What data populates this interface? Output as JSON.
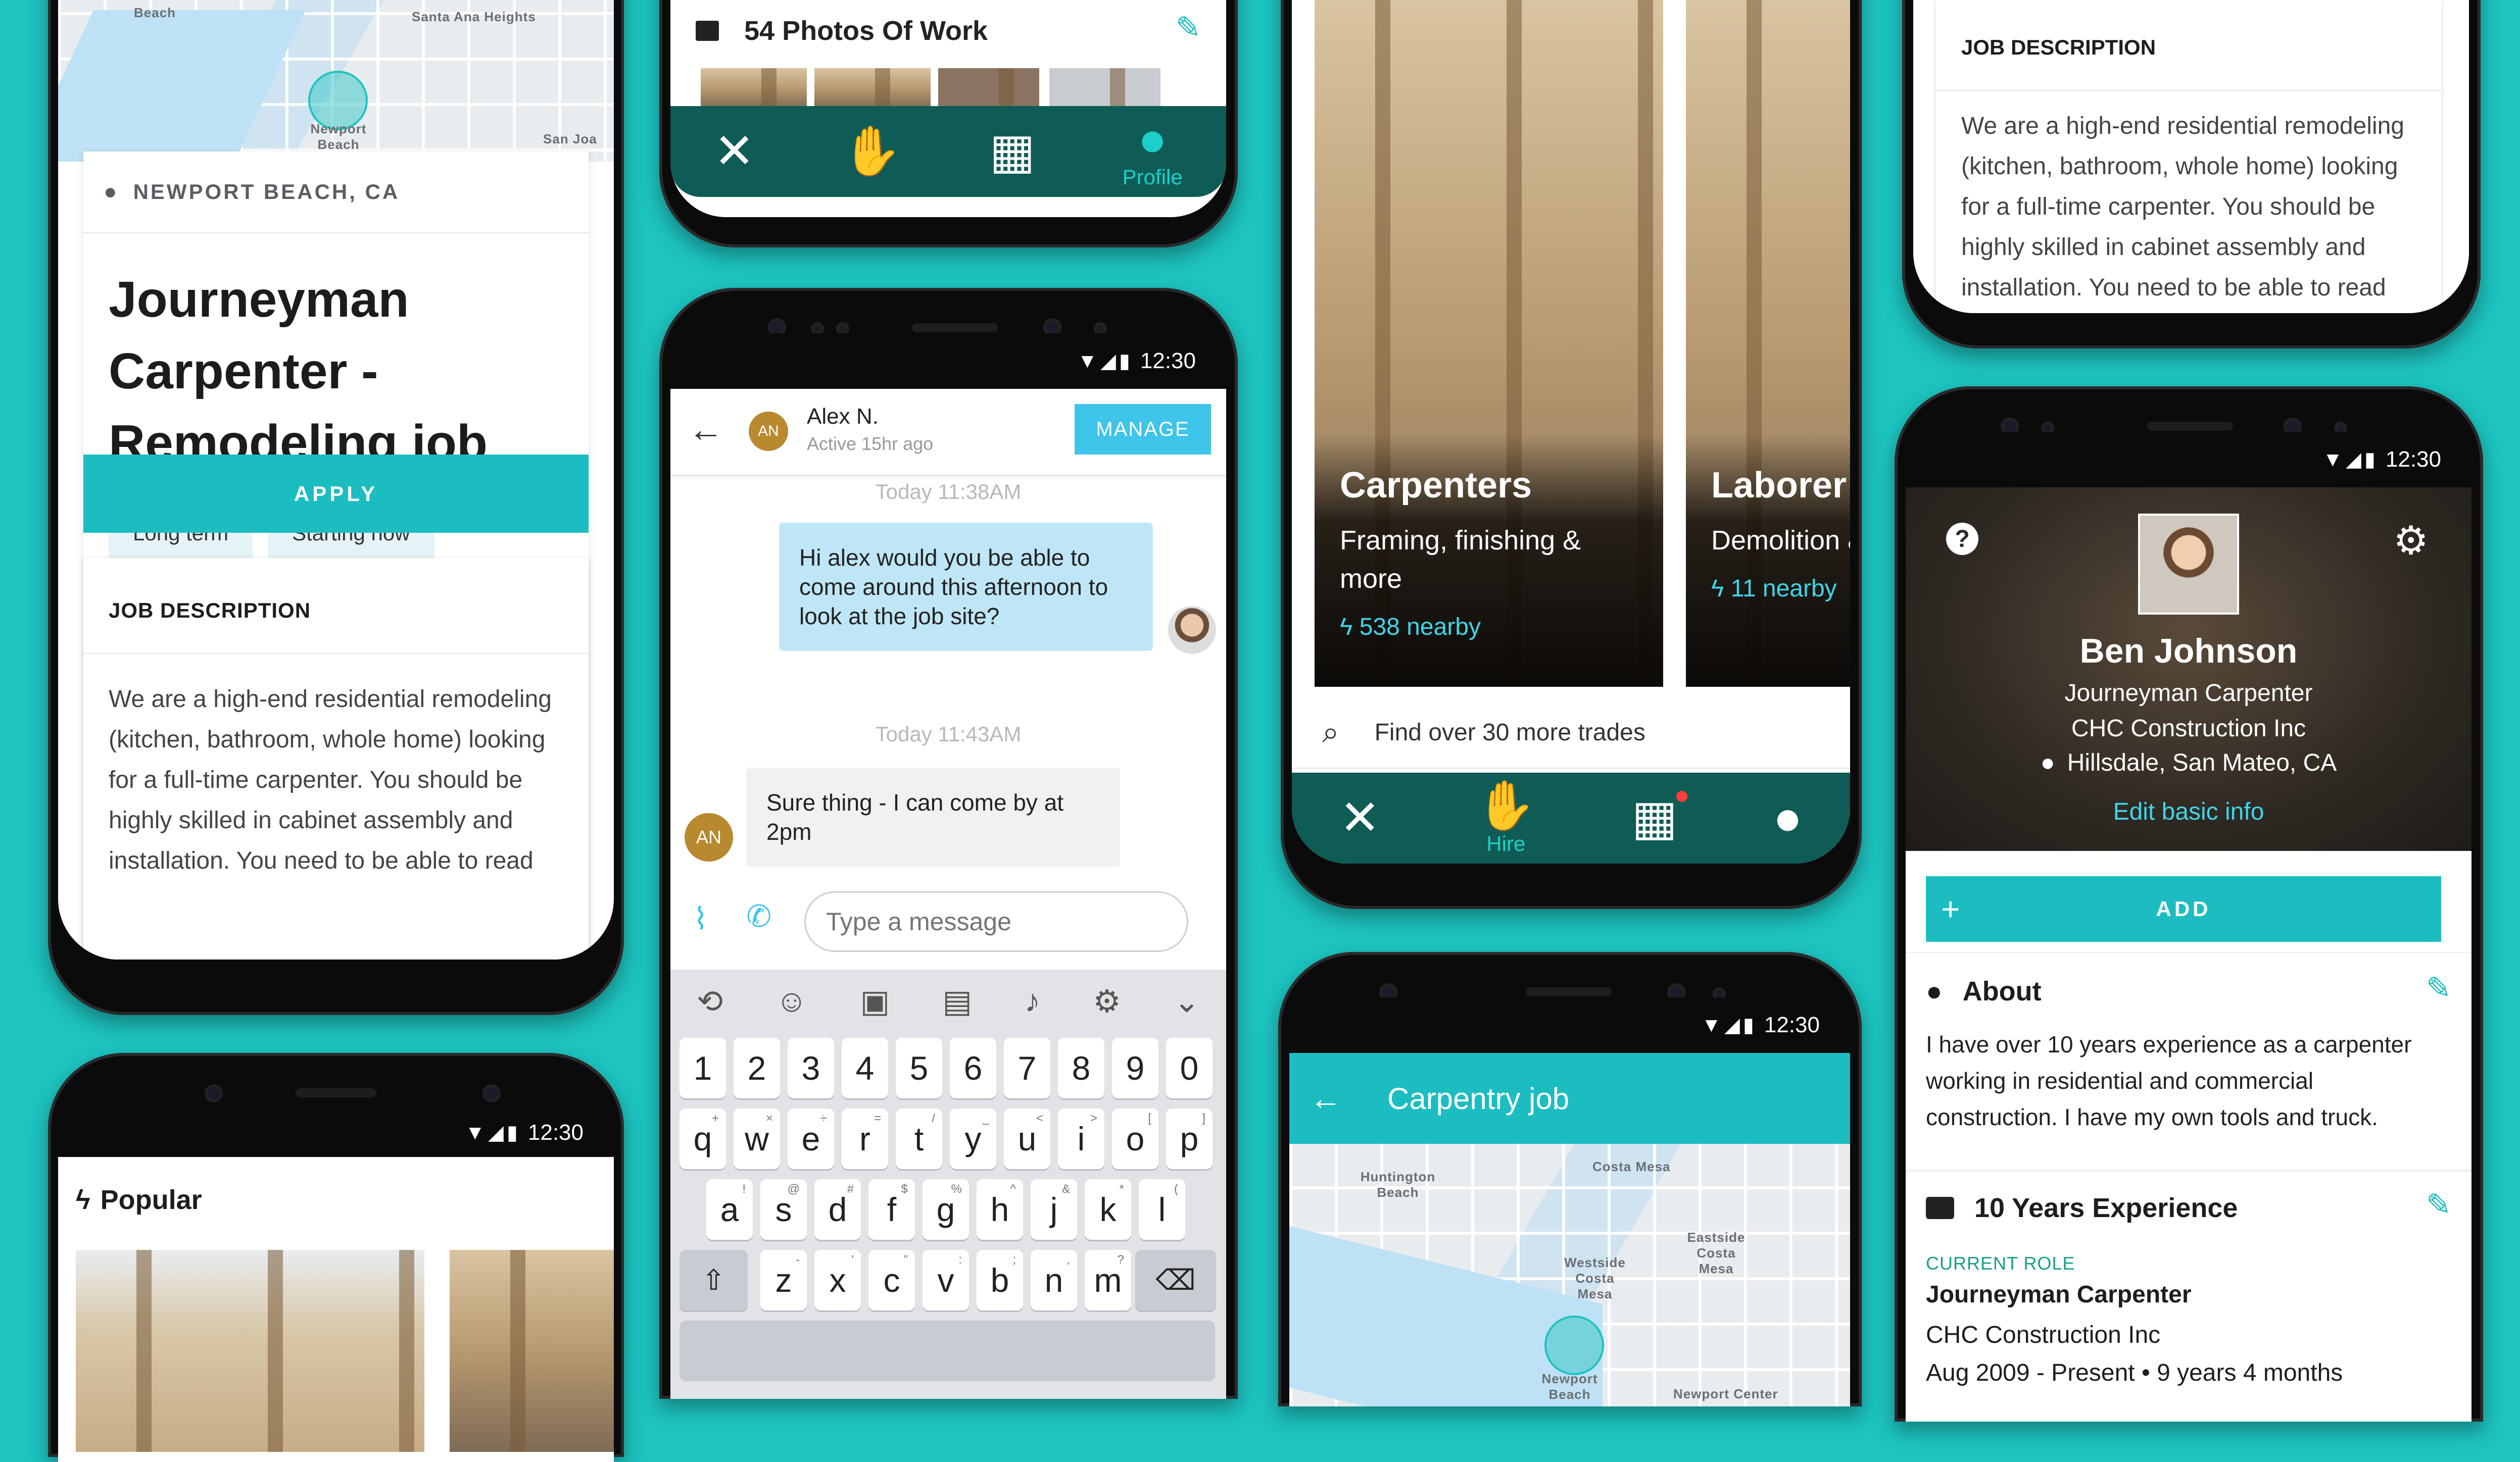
{
  "colors": {
    "background": "#1dc4c0",
    "accent": "#1bbdc1",
    "navbar": "#0f5c56"
  },
  "status_time": "12:30",
  "phone_job": {
    "map_labels": [
      "Beach",
      "Santa Ana Heights",
      "Newport Beach",
      "San Joa"
    ],
    "location": "NEWPORT BEACH, CA",
    "title": "Journeyman Carpenter - Remodeling job",
    "tags": [
      "Long term",
      "Starting now"
    ],
    "apply_label": "APPLY",
    "desc_heading": "JOB DESCRIPTION",
    "desc_text": "We are a high-end residential remodeling (kitchen, bathroom, whole home) looking for a full-time carpenter. You should be highly skilled in cabinet assembly and installation. You need to be able to read"
  },
  "phone_popular": {
    "heading": "Popular"
  },
  "phone_photos": {
    "title": "54 Photos Of Work",
    "nav": {
      "profile_label": "Profile"
    }
  },
  "phone_chat": {
    "contact_initials": "AN",
    "contact_name": "Alex N.",
    "contact_status": "Active 15hr ago",
    "manage_label": "MANAGE",
    "time1": "Today 11:38AM",
    "msg_out": "Hi alex would you be able to come around this afternoon to look at the job  site?",
    "time2": "Today 11:43AM",
    "msg_in": "Sure thing - I can come by at 2pm",
    "input_placeholder": "Type a message",
    "keyboard": {
      "numbers": [
        "1",
        "2",
        "3",
        "4",
        "5",
        "6",
        "7",
        "8",
        "9",
        "0"
      ],
      "row1": [
        "q",
        "w",
        "e",
        "r",
        "t",
        "y",
        "u",
        "i",
        "o",
        "p"
      ],
      "row1_sup": [
        "+",
        "×",
        "÷",
        "=",
        "/",
        "_",
        "<",
        ">",
        "[",
        "]"
      ],
      "row2": [
        "a",
        "s",
        "d",
        "f",
        "g",
        "h",
        "j",
        "k",
        "l"
      ],
      "row2_sup": [
        "!",
        "@",
        "#",
        "$",
        "%",
        "^",
        "&",
        "*",
        "("
      ],
      "row3": [
        "z",
        "x",
        "c",
        "v",
        "b",
        "n",
        "m"
      ],
      "row3_sup": [
        "-",
        "'",
        "\"",
        ":",
        ";",
        ",",
        "?"
      ]
    }
  },
  "phone_trades": {
    "cards": [
      {
        "title": "Carpenters",
        "subtitle": "Framing, finishing & more",
        "nearby": "538 nearby"
      },
      {
        "title": "Laborer",
        "subtitle": "Demolition & more",
        "nearby": "11 nearby"
      }
    ],
    "search_text": "Find over 30 more trades",
    "nav": {
      "hire_label": "Hire"
    }
  },
  "phone_map": {
    "title": "Carpentry job",
    "map_labels": [
      "Huntington Beach",
      "Costa Mesa",
      "Westside Costa Mesa",
      "Eastside Costa Mesa",
      "Newport Beach",
      "Newport Center"
    ]
  },
  "phone_desc": {
    "heading": "JOB DESCRIPTION",
    "text": "We are a high-end residential remodeling (kitchen, bathroom, whole home) looking for a full-time carpenter. You should be highly skilled in cabinet assembly and installation. You need to be able to read"
  },
  "phone_profile": {
    "name": "Ben Johnson",
    "role": "Journeyman Carpenter",
    "company": "CHC Construction Inc",
    "location": "Hillsdale, San Mateo, CA",
    "edit_label": "Edit basic info",
    "add_label": "ADD",
    "about_heading": "About",
    "about_text": "I have over 10 years experience as a carpenter working in residential and commercial construction. I have my own tools and truck.",
    "exp_heading": "10 Years Experience",
    "current_role_label": "CURRENT ROLE",
    "current_role": "Journeyman Carpenter",
    "current_company": "CHC Construction Inc",
    "current_dates": "Aug 2009 - Present • 9 years 4 months"
  }
}
